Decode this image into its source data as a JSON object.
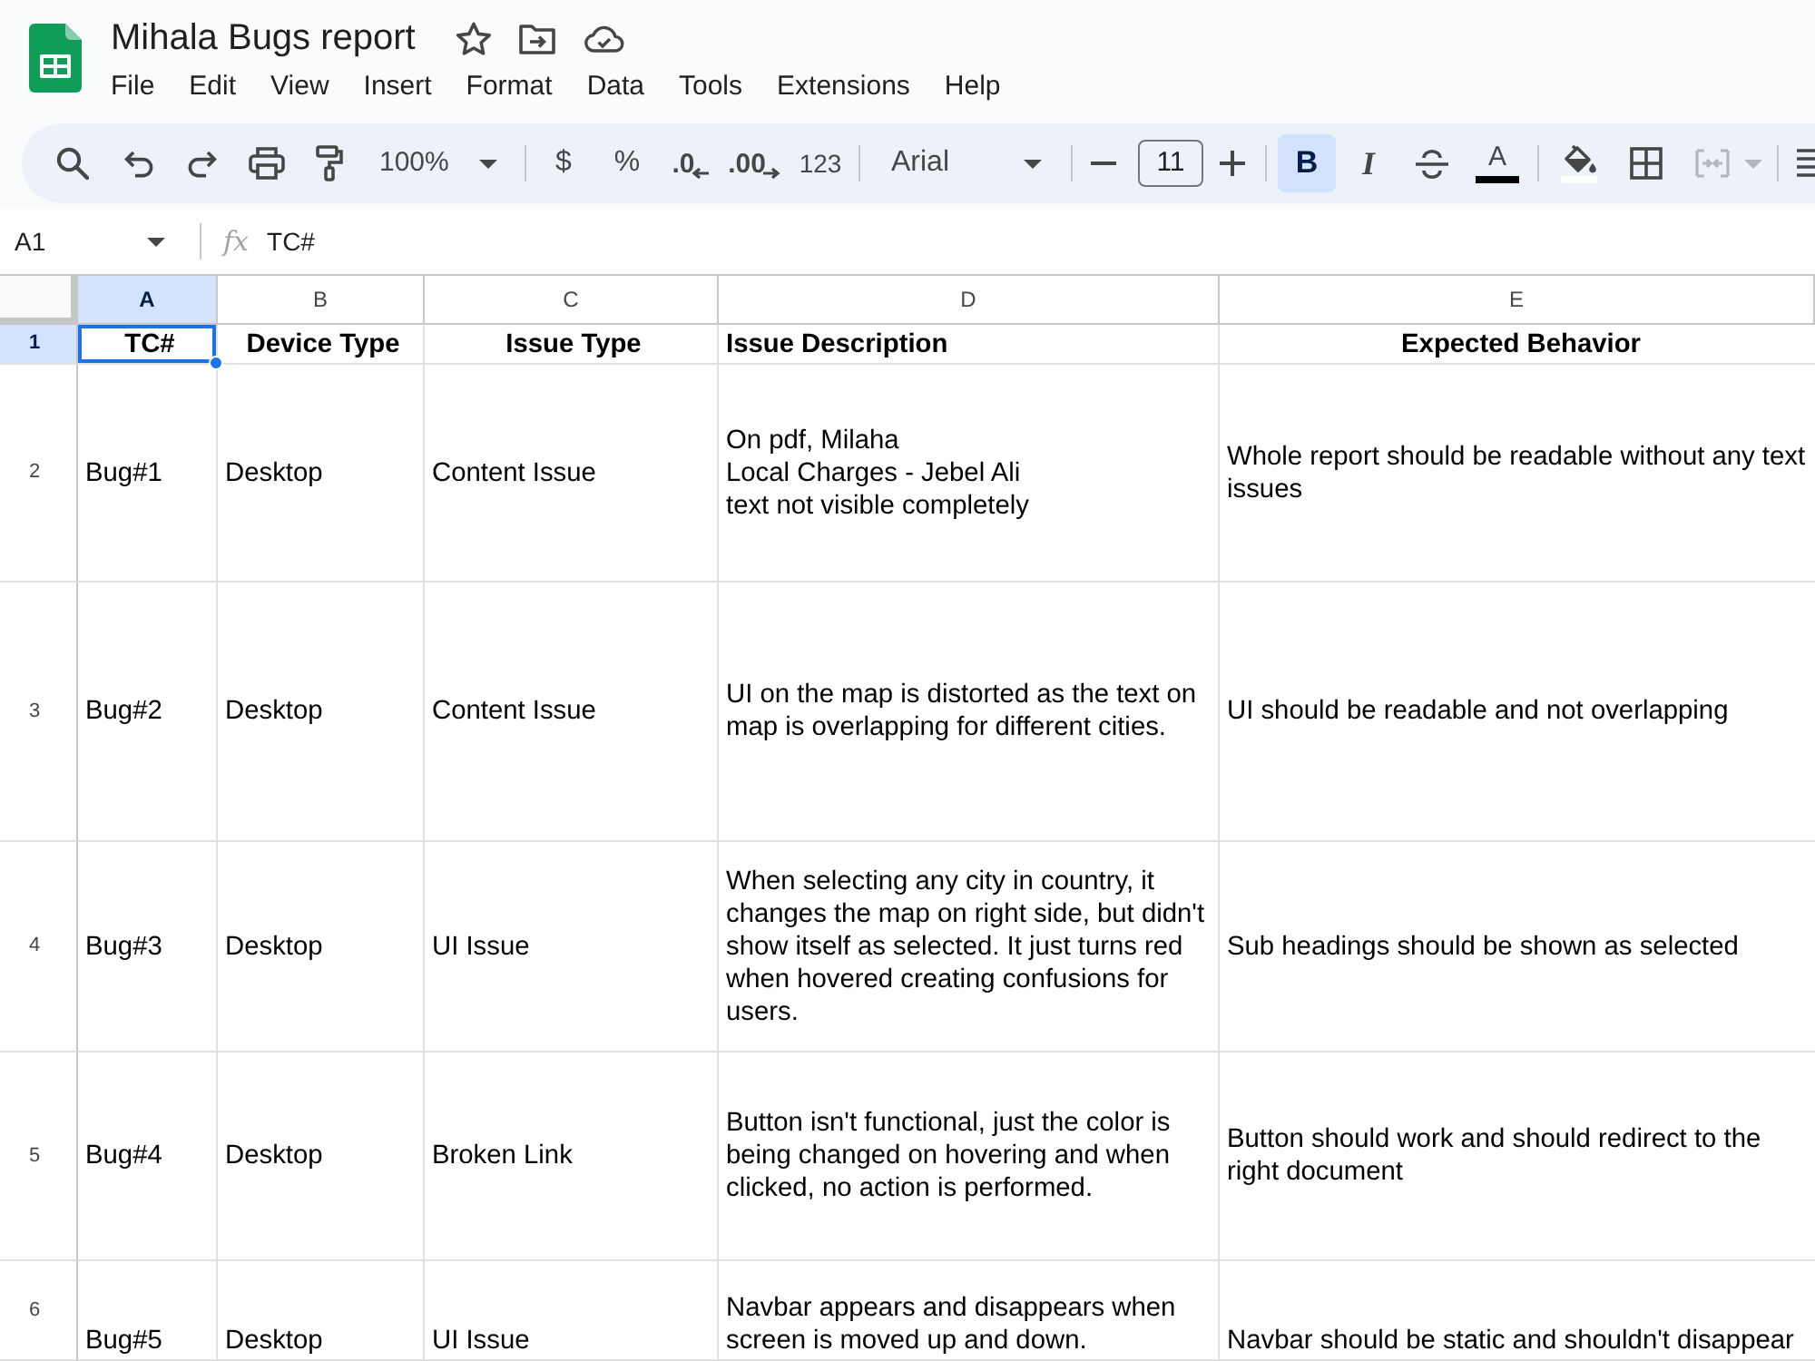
{
  "document": {
    "title": "Mihala Bugs report"
  },
  "menu": [
    "File",
    "Edit",
    "View",
    "Insert",
    "Format",
    "Data",
    "Tools",
    "Extensions",
    "Help"
  ],
  "toolbar": {
    "zoom": "100%",
    "currency": "$",
    "percent": "%",
    "decrease_decimal": ".0",
    "increase_decimal": ".00",
    "more_formats": "123",
    "font": "Arial",
    "font_size": "11",
    "bold": {
      "label": "B",
      "on": true
    },
    "italic": {
      "label": "I",
      "on": false
    },
    "strikethrough": {
      "on": false
    },
    "text_color_label": "A",
    "merge_cells": {
      "disabled": true
    }
  },
  "formula_bar": {
    "cell_ref": "A1",
    "fx": "fx",
    "value": "TC#"
  },
  "sheet": {
    "columns": [
      {
        "letter": "A",
        "selected": true
      },
      {
        "letter": "B",
        "selected": false
      },
      {
        "letter": "C",
        "selected": false
      },
      {
        "letter": "D",
        "selected": false
      },
      {
        "letter": "E",
        "selected": false
      }
    ],
    "rows": [
      {
        "number": "1",
        "kind": "header",
        "selected": true,
        "cells": [
          "TC#",
          "Device Type",
          "Issue Type",
          "Issue Description",
          "Expected Behavior"
        ]
      },
      {
        "number": "2",
        "kind": "data",
        "selected": false,
        "cells": [
          "Bug#1",
          "Desktop",
          "Content Issue",
          "On pdf, Milaha\nLocal Charges - Jebel Ali\ntext not visible completely",
          "Whole report should be readable without any text issues"
        ]
      },
      {
        "number": "3",
        "kind": "data",
        "selected": false,
        "cells": [
          "Bug#2",
          "Desktop",
          "Content Issue",
          "UI on the map is distorted as the text on map is overlapping for different cities.",
          "UI should be readable and not overlapping"
        ]
      },
      {
        "number": "4",
        "kind": "data",
        "selected": false,
        "cells": [
          "Bug#3",
          "Desktop",
          "UI Issue",
          "When selecting any city in country, it changes the map on right side, but didn't show itself as selected. It just turns red when hovered creating confusions for users.",
          "Sub headings should be shown as selected"
        ]
      },
      {
        "number": "5",
        "kind": "data",
        "selected": false,
        "cells": [
          "Bug#4",
          "Desktop",
          "Broken Link",
          "Button isn't functional, just the color is being changed on hovering and when clicked, no action is performed.",
          "Button should work and should redirect to the right document"
        ]
      },
      {
        "number": "6",
        "kind": "data",
        "selected": false,
        "cells": [
          "Bug#5",
          "Desktop",
          "UI Issue",
          "Navbar appears and disappears when screen is moved up and down.",
          "Navbar should be static and shouldn't disappear"
        ]
      }
    ]
  }
}
